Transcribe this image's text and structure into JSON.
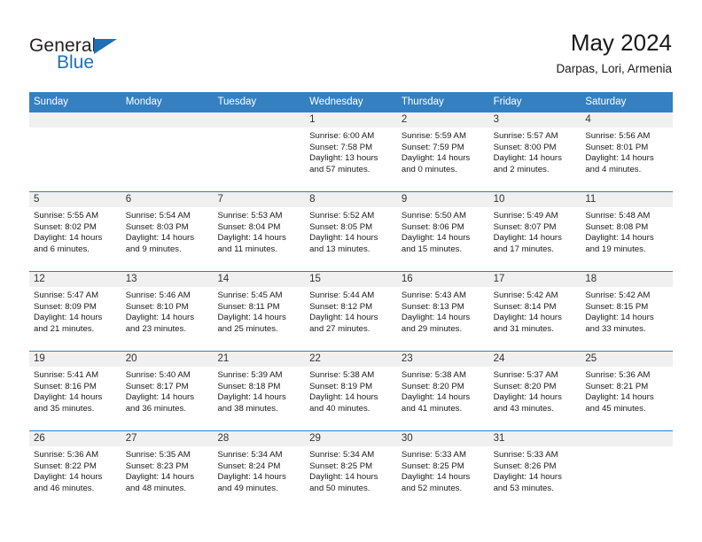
{
  "logo": {
    "word_top": "General",
    "word_bottom": "Blue",
    "accent_color": "#1f6fb5"
  },
  "header": {
    "title": "May 2024",
    "subtitle": "Darpas, Lori, Armenia"
  },
  "theme": {
    "header_bar_color": "#3580c0",
    "day_band_color": "#f0f0f0"
  },
  "weekdays": [
    "Sunday",
    "Monday",
    "Tuesday",
    "Wednesday",
    "Thursday",
    "Friday",
    "Saturday"
  ],
  "weeks": [
    [
      {
        "day": "",
        "sunrise": "",
        "sunset": "",
        "daylight_1": "",
        "daylight_2": ""
      },
      {
        "day": "",
        "sunrise": "",
        "sunset": "",
        "daylight_1": "",
        "daylight_2": ""
      },
      {
        "day": "",
        "sunrise": "",
        "sunset": "",
        "daylight_1": "",
        "daylight_2": ""
      },
      {
        "day": "1",
        "sunrise": "Sunrise: 6:00 AM",
        "sunset": "Sunset: 7:58 PM",
        "daylight_1": "Daylight: 13 hours",
        "daylight_2": "and 57 minutes."
      },
      {
        "day": "2",
        "sunrise": "Sunrise: 5:59 AM",
        "sunset": "Sunset: 7:59 PM",
        "daylight_1": "Daylight: 14 hours",
        "daylight_2": "and 0 minutes."
      },
      {
        "day": "3",
        "sunrise": "Sunrise: 5:57 AM",
        "sunset": "Sunset: 8:00 PM",
        "daylight_1": "Daylight: 14 hours",
        "daylight_2": "and 2 minutes."
      },
      {
        "day": "4",
        "sunrise": "Sunrise: 5:56 AM",
        "sunset": "Sunset: 8:01 PM",
        "daylight_1": "Daylight: 14 hours",
        "daylight_2": "and 4 minutes."
      }
    ],
    [
      {
        "day": "5",
        "sunrise": "Sunrise: 5:55 AM",
        "sunset": "Sunset: 8:02 PM",
        "daylight_1": "Daylight: 14 hours",
        "daylight_2": "and 6 minutes."
      },
      {
        "day": "6",
        "sunrise": "Sunrise: 5:54 AM",
        "sunset": "Sunset: 8:03 PM",
        "daylight_1": "Daylight: 14 hours",
        "daylight_2": "and 9 minutes."
      },
      {
        "day": "7",
        "sunrise": "Sunrise: 5:53 AM",
        "sunset": "Sunset: 8:04 PM",
        "daylight_1": "Daylight: 14 hours",
        "daylight_2": "and 11 minutes."
      },
      {
        "day": "8",
        "sunrise": "Sunrise: 5:52 AM",
        "sunset": "Sunset: 8:05 PM",
        "daylight_1": "Daylight: 14 hours",
        "daylight_2": "and 13 minutes."
      },
      {
        "day": "9",
        "sunrise": "Sunrise: 5:50 AM",
        "sunset": "Sunset: 8:06 PM",
        "daylight_1": "Daylight: 14 hours",
        "daylight_2": "and 15 minutes."
      },
      {
        "day": "10",
        "sunrise": "Sunrise: 5:49 AM",
        "sunset": "Sunset: 8:07 PM",
        "daylight_1": "Daylight: 14 hours",
        "daylight_2": "and 17 minutes."
      },
      {
        "day": "11",
        "sunrise": "Sunrise: 5:48 AM",
        "sunset": "Sunset: 8:08 PM",
        "daylight_1": "Daylight: 14 hours",
        "daylight_2": "and 19 minutes."
      }
    ],
    [
      {
        "day": "12",
        "sunrise": "Sunrise: 5:47 AM",
        "sunset": "Sunset: 8:09 PM",
        "daylight_1": "Daylight: 14 hours",
        "daylight_2": "and 21 minutes."
      },
      {
        "day": "13",
        "sunrise": "Sunrise: 5:46 AM",
        "sunset": "Sunset: 8:10 PM",
        "daylight_1": "Daylight: 14 hours",
        "daylight_2": "and 23 minutes."
      },
      {
        "day": "14",
        "sunrise": "Sunrise: 5:45 AM",
        "sunset": "Sunset: 8:11 PM",
        "daylight_1": "Daylight: 14 hours",
        "daylight_2": "and 25 minutes."
      },
      {
        "day": "15",
        "sunrise": "Sunrise: 5:44 AM",
        "sunset": "Sunset: 8:12 PM",
        "daylight_1": "Daylight: 14 hours",
        "daylight_2": "and 27 minutes."
      },
      {
        "day": "16",
        "sunrise": "Sunrise: 5:43 AM",
        "sunset": "Sunset: 8:13 PM",
        "daylight_1": "Daylight: 14 hours",
        "daylight_2": "and 29 minutes."
      },
      {
        "day": "17",
        "sunrise": "Sunrise: 5:42 AM",
        "sunset": "Sunset: 8:14 PM",
        "daylight_1": "Daylight: 14 hours",
        "daylight_2": "and 31 minutes."
      },
      {
        "day": "18",
        "sunrise": "Sunrise: 5:42 AM",
        "sunset": "Sunset: 8:15 PM",
        "daylight_1": "Daylight: 14 hours",
        "daylight_2": "and 33 minutes."
      }
    ],
    [
      {
        "day": "19",
        "sunrise": "Sunrise: 5:41 AM",
        "sunset": "Sunset: 8:16 PM",
        "daylight_1": "Daylight: 14 hours",
        "daylight_2": "and 35 minutes."
      },
      {
        "day": "20",
        "sunrise": "Sunrise: 5:40 AM",
        "sunset": "Sunset: 8:17 PM",
        "daylight_1": "Daylight: 14 hours",
        "daylight_2": "and 36 minutes."
      },
      {
        "day": "21",
        "sunrise": "Sunrise: 5:39 AM",
        "sunset": "Sunset: 8:18 PM",
        "daylight_1": "Daylight: 14 hours",
        "daylight_2": "and 38 minutes."
      },
      {
        "day": "22",
        "sunrise": "Sunrise: 5:38 AM",
        "sunset": "Sunset: 8:19 PM",
        "daylight_1": "Daylight: 14 hours",
        "daylight_2": "and 40 minutes."
      },
      {
        "day": "23",
        "sunrise": "Sunrise: 5:38 AM",
        "sunset": "Sunset: 8:20 PM",
        "daylight_1": "Daylight: 14 hours",
        "daylight_2": "and 41 minutes."
      },
      {
        "day": "24",
        "sunrise": "Sunrise: 5:37 AM",
        "sunset": "Sunset: 8:20 PM",
        "daylight_1": "Daylight: 14 hours",
        "daylight_2": "and 43 minutes."
      },
      {
        "day": "25",
        "sunrise": "Sunrise: 5:36 AM",
        "sunset": "Sunset: 8:21 PM",
        "daylight_1": "Daylight: 14 hours",
        "daylight_2": "and 45 minutes."
      }
    ],
    [
      {
        "day": "26",
        "sunrise": "Sunrise: 5:36 AM",
        "sunset": "Sunset: 8:22 PM",
        "daylight_1": "Daylight: 14 hours",
        "daylight_2": "and 46 minutes."
      },
      {
        "day": "27",
        "sunrise": "Sunrise: 5:35 AM",
        "sunset": "Sunset: 8:23 PM",
        "daylight_1": "Daylight: 14 hours",
        "daylight_2": "and 48 minutes."
      },
      {
        "day": "28",
        "sunrise": "Sunrise: 5:34 AM",
        "sunset": "Sunset: 8:24 PM",
        "daylight_1": "Daylight: 14 hours",
        "daylight_2": "and 49 minutes."
      },
      {
        "day": "29",
        "sunrise": "Sunrise: 5:34 AM",
        "sunset": "Sunset: 8:25 PM",
        "daylight_1": "Daylight: 14 hours",
        "daylight_2": "and 50 minutes."
      },
      {
        "day": "30",
        "sunrise": "Sunrise: 5:33 AM",
        "sunset": "Sunset: 8:25 PM",
        "daylight_1": "Daylight: 14 hours",
        "daylight_2": "and 52 minutes."
      },
      {
        "day": "31",
        "sunrise": "Sunrise: 5:33 AM",
        "sunset": "Sunset: 8:26 PM",
        "daylight_1": "Daylight: 14 hours",
        "daylight_2": "and 53 minutes."
      },
      {
        "day": "",
        "sunrise": "",
        "sunset": "",
        "daylight_1": "",
        "daylight_2": ""
      }
    ]
  ]
}
